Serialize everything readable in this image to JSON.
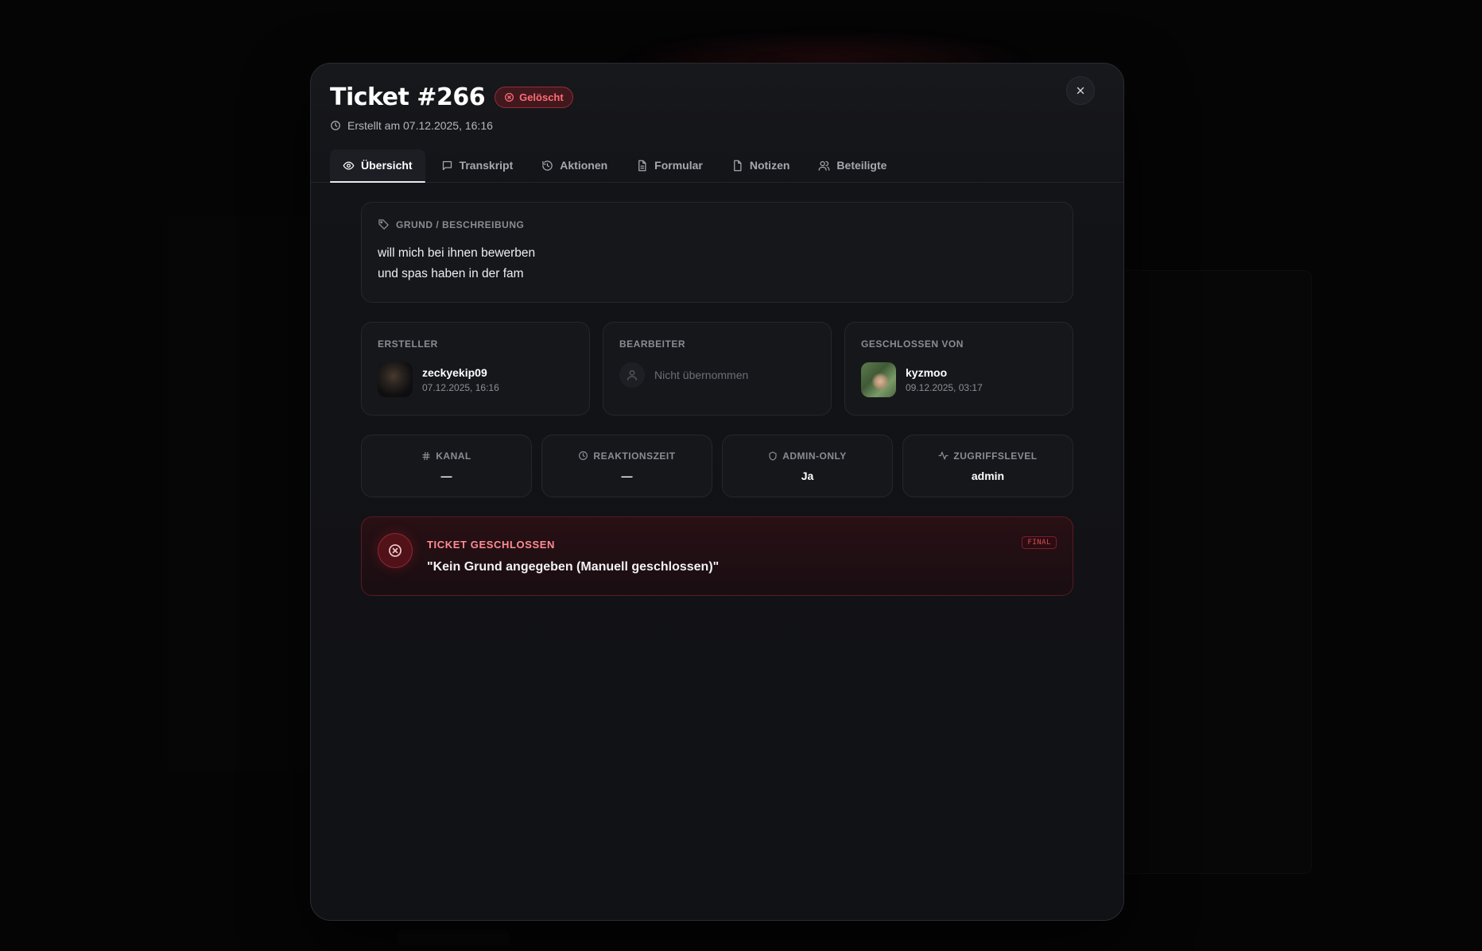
{
  "ticket": {
    "title": "Ticket #266",
    "status": "Gelöscht",
    "created": "Erstellt am 07.12.2025, 16:16"
  },
  "tabs": [
    {
      "label": "Übersicht",
      "icon": "eye-icon",
      "active": true
    },
    {
      "label": "Transkript",
      "icon": "message-icon"
    },
    {
      "label": "Aktionen",
      "icon": "history-icon"
    },
    {
      "label": "Formular",
      "icon": "document-icon"
    },
    {
      "label": "Notizen",
      "icon": "note-icon"
    },
    {
      "label": "Beteiligte",
      "icon": "users-icon"
    }
  ],
  "reason": {
    "label": "Grund / Beschreibung",
    "line1": "will mich bei ihnen bewerben",
    "line2": "und spas haben in der fam"
  },
  "people": {
    "creator": {
      "label": "Ersteller",
      "name": "zeckyekip09",
      "date": "07.12.2025, 16:16"
    },
    "editor": {
      "label": "Bearbeiter",
      "empty": "Nicht übernommen"
    },
    "closer": {
      "label": "Geschlossen von",
      "name": "kyzmoo",
      "date": "09.12.2025, 03:17"
    }
  },
  "stats": {
    "channel": {
      "label": "Kanal",
      "value": "—"
    },
    "reaction": {
      "label": "Reaktionszeit",
      "value": "—"
    },
    "admin_only": {
      "label": "Admin-Only",
      "value": "Ja"
    },
    "access": {
      "label": "Zugriffslevel",
      "value": "admin"
    }
  },
  "closed": {
    "title": "Ticket geschlossen",
    "reason": "\"Kein Grund angegeben (Manuell geschlossen)\"",
    "badge": "FINAL"
  },
  "colors": {
    "accent_red": "#ff6b72",
    "modal_bg": "#121317"
  }
}
